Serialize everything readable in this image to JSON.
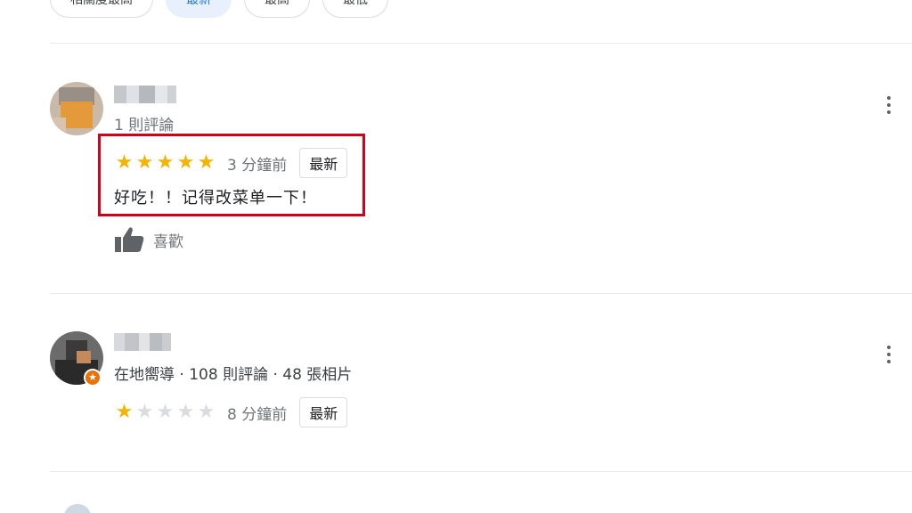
{
  "filters": [
    {
      "label": "相關度最高",
      "active": false
    },
    {
      "label": "最新",
      "active": true
    },
    {
      "label": "最高",
      "active": false
    },
    {
      "label": "最低",
      "active": false
    }
  ],
  "reviews": [
    {
      "meta": "1 則評論",
      "rating": 5,
      "time": "3 分鐘前",
      "badge": "最新",
      "text": "好吃！！记得改菜单一下！",
      "like_label": "喜歡"
    },
    {
      "meta": "在地嚮導 · 108 則評論 · 48 張相片",
      "rating": 1,
      "time": "8 分鐘前",
      "badge": "最新"
    }
  ],
  "colors": {
    "star_filled": "#f4b400",
    "star_empty": "#dadce0",
    "highlight_box": "#d0021b",
    "local_guide_badge": "#e8710a"
  },
  "icons": {
    "more": "more-vert-icon",
    "like": "thumb-up-icon",
    "guide": "local-guide-star-icon"
  }
}
